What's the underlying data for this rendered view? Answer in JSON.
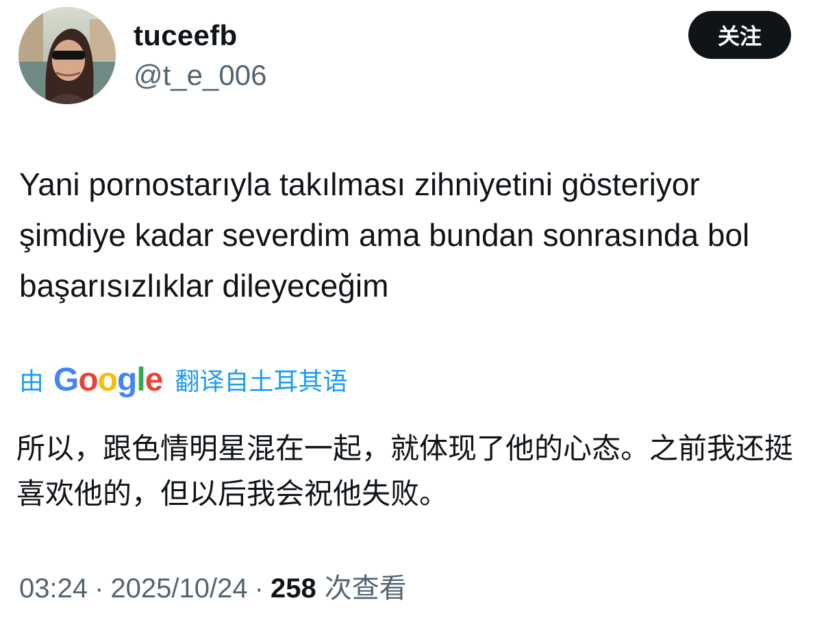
{
  "author": {
    "display_name": "tuceefb",
    "handle": "@t_e_006"
  },
  "follow_button": {
    "label": "关注"
  },
  "tweet": {
    "text": "Yani pornostarıyla takılması zihniyetini gösteriyor şimdiye kadar severdim ama bundan sonrasında bol başarısızlıklar dileyeceğim"
  },
  "translation": {
    "prefix": "由",
    "provider_letters": [
      "G",
      "o",
      "o",
      "g",
      "l",
      "e"
    ],
    "provider_colors": [
      "#4285f4",
      "#ea4335",
      "#fbbc05",
      "#4285f4",
      "#34a853",
      "#ea4335"
    ],
    "suffix": "翻译自土耳其语",
    "text": "所以，跟色情明星混在一起，就体现了他的心态。之前我还挺喜欢他的，但以后我会祝他失败。"
  },
  "meta": {
    "time": "03:24",
    "separator": "·",
    "date": "2025/10/24",
    "views_count": "258",
    "views_label": "次查看"
  },
  "colors": {
    "text_primary": "#0f1419",
    "text_secondary": "#536471",
    "link": "#1d9bf0",
    "button_bg": "#0f1419"
  }
}
